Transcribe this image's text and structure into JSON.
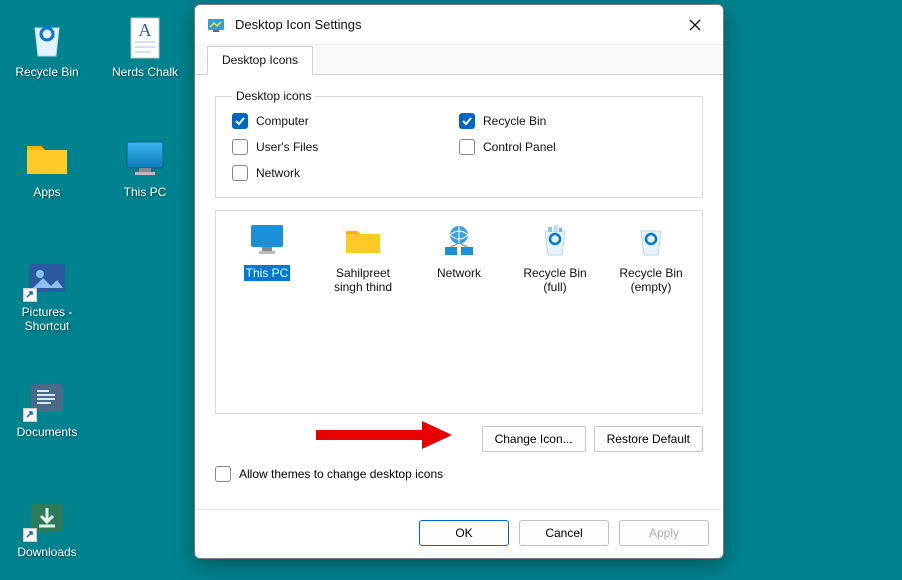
{
  "desktop": {
    "icons": [
      {
        "name": "recycle-bin",
        "label": "Recycle Bin",
        "kind": "recycle-empty"
      },
      {
        "name": "nerds-chalk",
        "label": "Nerds Chalk",
        "kind": "doc"
      },
      {
        "name": "apps",
        "label": "Apps",
        "kind": "folder"
      },
      {
        "name": "this-pc",
        "label": "This PC",
        "kind": "monitor"
      },
      {
        "name": "pictures-shortcut",
        "label": "Pictures - Shortcut",
        "kind": "pictures",
        "shortcut": true
      },
      {
        "name": "documents",
        "label": "Documents",
        "kind": "documents",
        "shortcut": true
      },
      {
        "name": "downloads",
        "label": "Downloads",
        "kind": "downloads",
        "shortcut": true
      }
    ]
  },
  "dialog": {
    "title": "Desktop Icon Settings",
    "tab": "Desktop Icons",
    "group_label": "Desktop icons",
    "checks": [
      {
        "key": "computer",
        "label": "Computer",
        "checked": true
      },
      {
        "key": "recycle_bin",
        "label": "Recycle Bin",
        "checked": true
      },
      {
        "key": "users_files",
        "label": "User's Files",
        "checked": false
      },
      {
        "key": "control_panel",
        "label": "Control Panel",
        "checked": false
      },
      {
        "key": "network",
        "label": "Network",
        "checked": false
      }
    ],
    "preview": [
      {
        "label": "This PC",
        "kind": "monitor",
        "selected": true
      },
      {
        "label": "Sahilpreet singh thind",
        "kind": "folder",
        "selected": false
      },
      {
        "label": "Network",
        "kind": "network",
        "selected": false
      },
      {
        "label": "Recycle Bin (full)",
        "kind": "recycle-full",
        "selected": false
      },
      {
        "label": "Recycle Bin (empty)",
        "kind": "recycle-empty",
        "selected": false
      }
    ],
    "change_icon_btn": "Change Icon...",
    "restore_default_btn": "Restore Default",
    "allow_themes_label": "Allow themes to change desktop icons",
    "allow_themes_checked": false,
    "ok_btn": "OK",
    "cancel_btn": "Cancel",
    "apply_btn": "Apply"
  }
}
